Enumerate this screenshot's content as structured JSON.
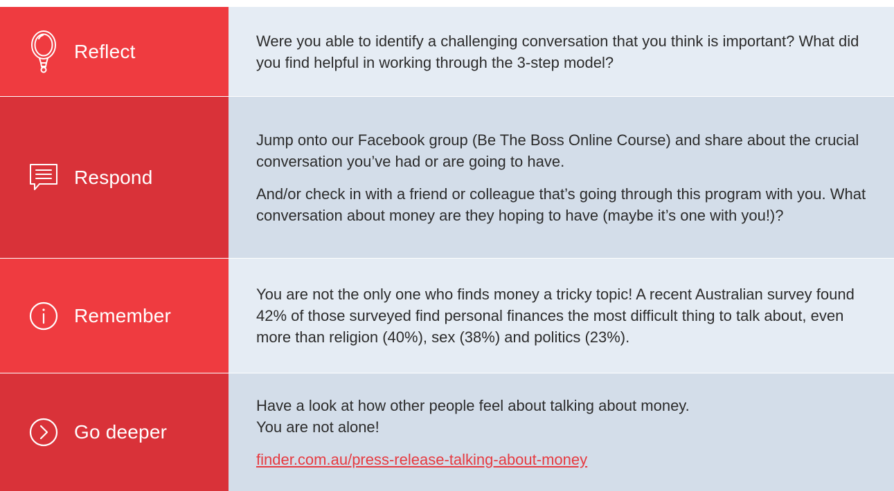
{
  "rows": [
    {
      "label": "Reflect",
      "icon": "mirror-icon",
      "paragraphs": [
        "Were you able to identify a challenging conversation that you think is important? What did you find helpful in working through the 3-step model?"
      ]
    },
    {
      "label": "Respond",
      "icon": "chat-bubble-icon",
      "paragraphs": [
        "Jump onto our Facebook group (Be The Boss Online Course) and share about the crucial conversation you’ve had or are going to have.",
        "And/or check in with a friend or colleague that’s going through this program with you. What conversation about money are they hoping to have (maybe it’s one with you!)?"
      ]
    },
    {
      "label": "Remember",
      "icon": "info-icon",
      "paragraphs": [
        "You are not the only one who finds money a tricky topic! A recent Australian survey found 42% of those surveyed find personal finances the most difficult thing to talk about, even more than religion (40%), sex (38%) and politics (23%)."
      ]
    },
    {
      "label": "Go deeper",
      "icon": "chevron-right-circle-icon",
      "paragraphs": [
        "Have a look at how other people feel about talking about money.",
        "You are not alone!"
      ],
      "link": "finder.com.au/press-release-talking-about-money"
    }
  ],
  "colors": {
    "label_light": "#ef3b40",
    "label_dark": "#d93239",
    "content_light": "#e5ecf4",
    "content_dark": "#d3dde9",
    "link": "#e63a40"
  }
}
